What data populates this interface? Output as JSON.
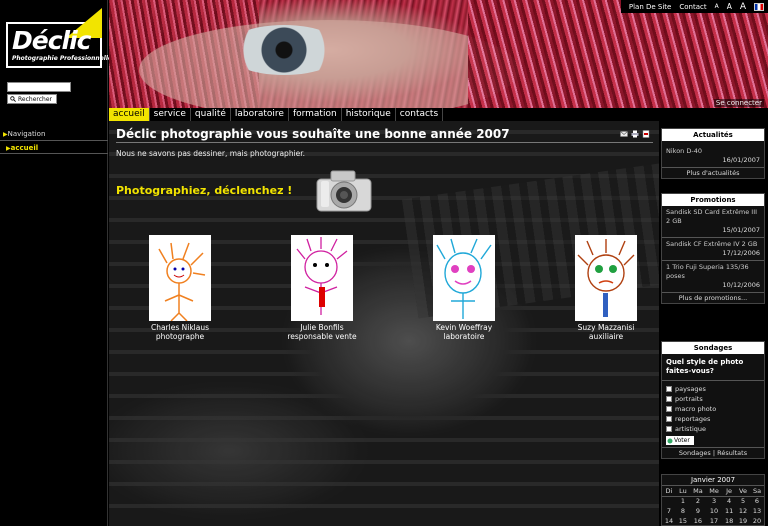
{
  "logo": {
    "name": "Déclic",
    "subtitle": "Photographie Professionnelle"
  },
  "search": {
    "button": "Rechercher",
    "value": ""
  },
  "sidebar": {
    "nav_label": "Navigation",
    "items": [
      {
        "label": "accueil"
      }
    ]
  },
  "toplinks": {
    "sitemap": "Plan De Site",
    "contact": "Contact",
    "a1": "A",
    "a2": "A",
    "a3": "A"
  },
  "header": {
    "connect": "Se connecter"
  },
  "menu": {
    "tabs": [
      {
        "label": "accueil",
        "active": true
      },
      {
        "label": "service"
      },
      {
        "label": "qualité"
      },
      {
        "label": "laboratoire"
      },
      {
        "label": "formation"
      },
      {
        "label": "historique"
      },
      {
        "label": "contacts"
      }
    ]
  },
  "main": {
    "title": "Déclic photographie vous souhaîte une bonne année 2007",
    "intro": "Nous ne savons pas dessiner, mais photographier.",
    "slogan": "Photographiez, déclenchez !",
    "team": [
      {
        "name": "Charles Niklaus",
        "role": "photographe"
      },
      {
        "name": "Julie Bonfils",
        "role": "responsable vente"
      },
      {
        "name": "Kevin Woeffray",
        "role": "laboratoire"
      },
      {
        "name": "Suzy Mazzanisi",
        "role": "auxiliaire"
      }
    ]
  },
  "actualites": {
    "title": "Actualités",
    "items": [
      {
        "text": "Nikon D-40",
        "date": "16/01/2007"
      }
    ],
    "more": "Plus d'actualités"
  },
  "promotions": {
    "title": "Promotions",
    "items": [
      {
        "text": "Sandisk SD Card Extrême III 2 GB",
        "date": "15/01/2007"
      },
      {
        "text": "Sandisk CF Extrême IV 2 GB",
        "date": "17/12/2006"
      },
      {
        "text": "1 Trio Fuji Superia 135/36 poses",
        "date": "10/12/2006"
      }
    ],
    "more": "Plus de promotions..."
  },
  "sondages": {
    "title": "Sondages",
    "question": "Quel style de photo faites-vous?",
    "options": [
      "paysages",
      "portraits",
      "macro photo",
      "reportages",
      "artistique"
    ],
    "vote": "Voter",
    "footer_left": "Sondages",
    "footer_sep": "|",
    "footer_right": "Résultats"
  },
  "calendar": {
    "title": "Janvier 2007",
    "days": [
      "Di",
      "Lu",
      "Ma",
      "Me",
      "Je",
      "Ve",
      "Sa"
    ],
    "rows": [
      [
        "",
        "1",
        "2",
        "3",
        "4",
        "5",
        "6"
      ],
      [
        "7",
        "8",
        "9",
        "10",
        "11",
        "12",
        "13"
      ],
      [
        "14",
        "15",
        "16",
        "17",
        "18",
        "19",
        "20"
      ]
    ]
  },
  "colors": {
    "accent": "#f2e400"
  }
}
